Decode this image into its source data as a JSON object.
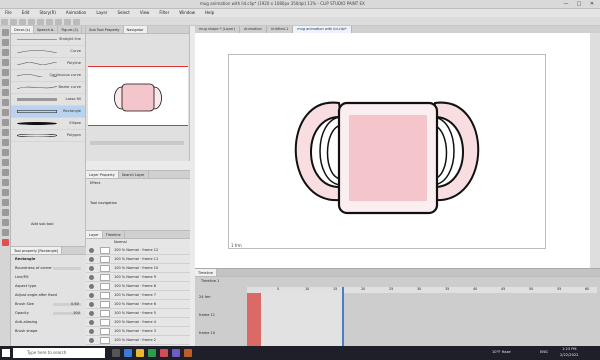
{
  "window": {
    "title": "mug animation with lid.clip* (1920 x 1080px 350dpi) 11% - CLIP STUDIO PAINT EX",
    "controls": [
      "—",
      "□",
      "✕"
    ]
  },
  "menu": [
    "File",
    "Edit",
    "Story(R)",
    "Animation",
    "Layer",
    "Select",
    "View",
    "Filter",
    "Window",
    "Help"
  ],
  "subtool": {
    "tabs": [
      "Decor-(s)",
      "Speech b-",
      "Figure-(1)"
    ],
    "items": [
      {
        "label": "Straight line"
      },
      {
        "label": "Curve"
      },
      {
        "label": "Polyline"
      },
      {
        "label": "Continuous curve"
      },
      {
        "label": "Bezier curve"
      },
      {
        "label": "Lasso fill"
      },
      {
        "label": "Rectangle"
      },
      {
        "label": "Ellipse"
      },
      {
        "label": "Polygon"
      }
    ],
    "add_label": "Add sub tool"
  },
  "navigator": {
    "tabs": [
      "Sub Tool Property",
      "Navigator"
    ]
  },
  "layer_property": {
    "tabs": [
      "Layer Property",
      "Search Layer"
    ],
    "effect_label": "Effect",
    "tool_navigation_label": "Tool navigation"
  },
  "tool_property": {
    "tab": "Tool property [Rectangle]",
    "title": "Rectangle",
    "rows": [
      {
        "label": "Roundness of corner",
        "value": ""
      },
      {
        "label": "Line/Fill",
        "value": ""
      },
      {
        "label": "Aspect type",
        "value": ""
      },
      {
        "label": "Adjust angle after fixed",
        "value": ""
      },
      {
        "label": "Brush Size",
        "value": "0.60"
      },
      {
        "label": "Opacity",
        "value": "100"
      },
      {
        "label": "Anti-aliasing",
        "value": ""
      },
      {
        "label": "Brush shape",
        "value": ""
      }
    ]
  },
  "layers": {
    "tabs": [
      "Layer",
      "Timeline"
    ],
    "blend": "Normal",
    "items": [
      {
        "name": "100 % Normal · frame 12"
      },
      {
        "name": "100 % Normal · frame 11"
      },
      {
        "name": "100 % Normal · frame 10"
      },
      {
        "name": "100 % Normal · frame 9"
      },
      {
        "name": "100 % Normal · frame 8"
      },
      {
        "name": "100 % Normal · frame 7"
      },
      {
        "name": "100 % Normal · frame 6"
      },
      {
        "name": "100 % Normal · frame 5"
      },
      {
        "name": "100 % Normal · frame 4"
      },
      {
        "name": "100 % Normal · frame 3"
      },
      {
        "name": "100 % Normal · frame 2"
      },
      {
        "name": "100 % Normal · frame 1"
      }
    ]
  },
  "doc_tabs": [
    "mug shape * (Layer)",
    "Animation",
    "Untitled-1",
    "mug animation with lid.clip*"
  ],
  "canvas": {
    "frame_label": "1 frm"
  },
  "timeline": {
    "tab": "Timeline",
    "name": "Timeline 1",
    "frame_numbers": [
      "5",
      "10",
      "15",
      "20",
      "25",
      "30",
      "35",
      "40",
      "45",
      "50",
      "55",
      "60"
    ],
    "tracks": [
      "24 frm",
      "frame 11",
      "frame 10"
    ]
  },
  "taskbar": {
    "search_placeholder": "Type here to search",
    "weather": "10°F Haze",
    "lang": "ENG",
    "time": "1:23 PM",
    "date": "2/22/2022"
  },
  "colors": {
    "accent_blue": "#4a7fc1",
    "mug_pink": "#f4c6cb",
    "timeline_red": "#d9534f"
  }
}
